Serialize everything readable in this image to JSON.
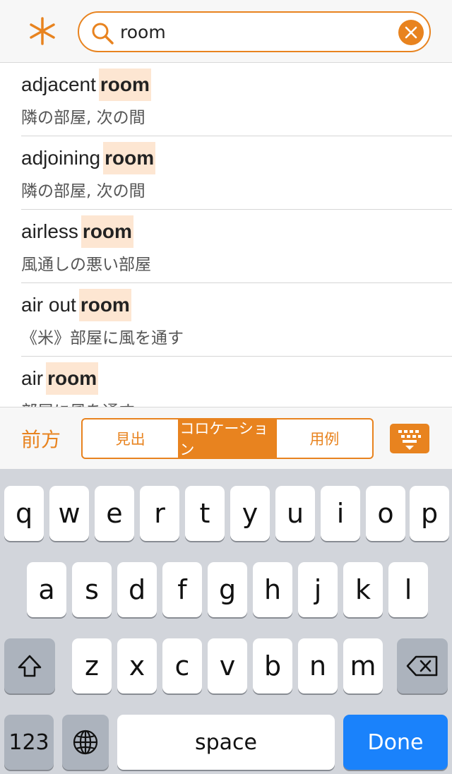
{
  "search": {
    "query": "room",
    "placeholder": ""
  },
  "results": [
    {
      "prefix": "adjacent",
      "match": "room",
      "ja": "隣の部屋, 次の間"
    },
    {
      "prefix": "adjoining",
      "match": "room",
      "ja": "隣の部屋, 次の間"
    },
    {
      "prefix": "airless",
      "match": "room",
      "ja": "風通しの悪い部屋"
    },
    {
      "prefix": "air out",
      "match": "room",
      "ja": "《米》部屋に風を通す"
    },
    {
      "prefix": "air",
      "match": "room",
      "ja": "部屋に風を通す"
    }
  ],
  "modebar": {
    "direction": "前方",
    "tabs": [
      "見出",
      "コロケーション",
      "用例"
    ],
    "active_tab": "コロケーション"
  },
  "keyboard": {
    "row1": [
      "q",
      "w",
      "e",
      "r",
      "t",
      "y",
      "u",
      "i",
      "o",
      "p"
    ],
    "row2": [
      "a",
      "s",
      "d",
      "f",
      "g",
      "h",
      "j",
      "k",
      "l"
    ],
    "row3": [
      "z",
      "x",
      "c",
      "v",
      "b",
      "n",
      "m"
    ],
    "numbers_label": "123",
    "space_label": "space",
    "done_label": "Done"
  },
  "colors": {
    "accent": "#e8831f",
    "highlight": "#fde6d2",
    "done_blue": "#1a82fb"
  },
  "icons": [
    "asterisk-icon",
    "search-icon",
    "clear-icon",
    "keyboard-icon",
    "shift-icon",
    "globe-icon",
    "delete-icon"
  ]
}
